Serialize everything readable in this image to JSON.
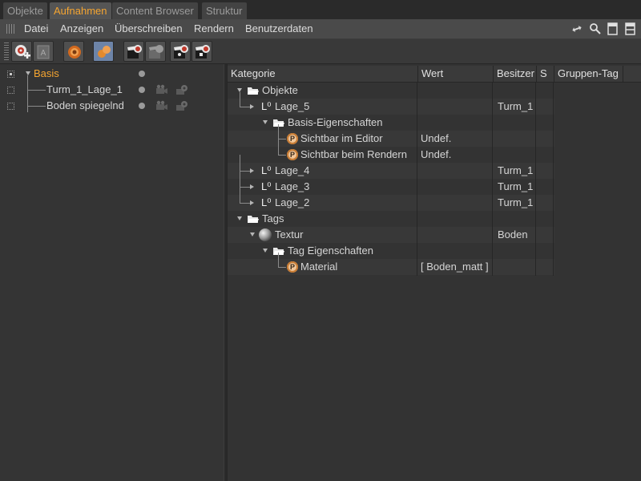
{
  "tabs": [
    "Objekte",
    "Aufnahmen",
    "Content Browser",
    "Struktur"
  ],
  "active_tab": "Aufnahmen",
  "menu": [
    "Datei",
    "Anzeigen",
    "Überschreiben",
    "Rendern",
    "Benutzerdaten"
  ],
  "menu_icons": [
    "arrows-icon",
    "search-icon",
    "single-panel-icon",
    "dual-panel-icon"
  ],
  "toolbar_icons": [
    "add-take-icon",
    "auto-take-icon",
    "override-icon",
    "override-group-icon",
    "render-clapper-icon",
    "render-clapper-disabled-icon",
    "share-clapper-icon",
    "share-clapper-2-icon"
  ],
  "takes": [
    {
      "label": "Basis",
      "highlight": "#f5a531"
    },
    {
      "label": "Turm_1_Lage_1"
    },
    {
      "label": "Boden spiegelnd"
    }
  ],
  "table": {
    "headers": [
      "Kategorie",
      "Wert",
      "Besitzer",
      "S",
      "Gruppen-Tag"
    ],
    "rows": [
      {
        "kategorie": "Objekte",
        "wert": "",
        "besitzer": ""
      },
      {
        "kategorie": "Lage_5",
        "wert": "",
        "besitzer": "Turm_1"
      },
      {
        "kategorie": "Basis-Eigenschaften",
        "wert": "",
        "besitzer": ""
      },
      {
        "kategorie": "Sichtbar im Editor",
        "wert": "Undef.",
        "besitzer": ""
      },
      {
        "kategorie": "Sichtbar beim Rendern",
        "wert": "Undef.",
        "besitzer": ""
      },
      {
        "kategorie": "Lage_4",
        "wert": "",
        "besitzer": "Turm_1"
      },
      {
        "kategorie": "Lage_3",
        "wert": "",
        "besitzer": "Turm_1"
      },
      {
        "kategorie": "Lage_2",
        "wert": "",
        "besitzer": "Turm_1"
      },
      {
        "kategorie": "Tags",
        "wert": "",
        "besitzer": ""
      },
      {
        "kategorie": "Textur",
        "wert": "",
        "besitzer": "Boden"
      },
      {
        "kategorie": "Tag Eigenschaften",
        "wert": "",
        "besitzer": ""
      },
      {
        "kategorie": "Material",
        "wert": "[ Boden_matt ]",
        "besitzer": ""
      }
    ]
  },
  "colors": {
    "accent": "#f5a531",
    "background": "#2f2f2f",
    "selected_button": "#6d84a8"
  }
}
